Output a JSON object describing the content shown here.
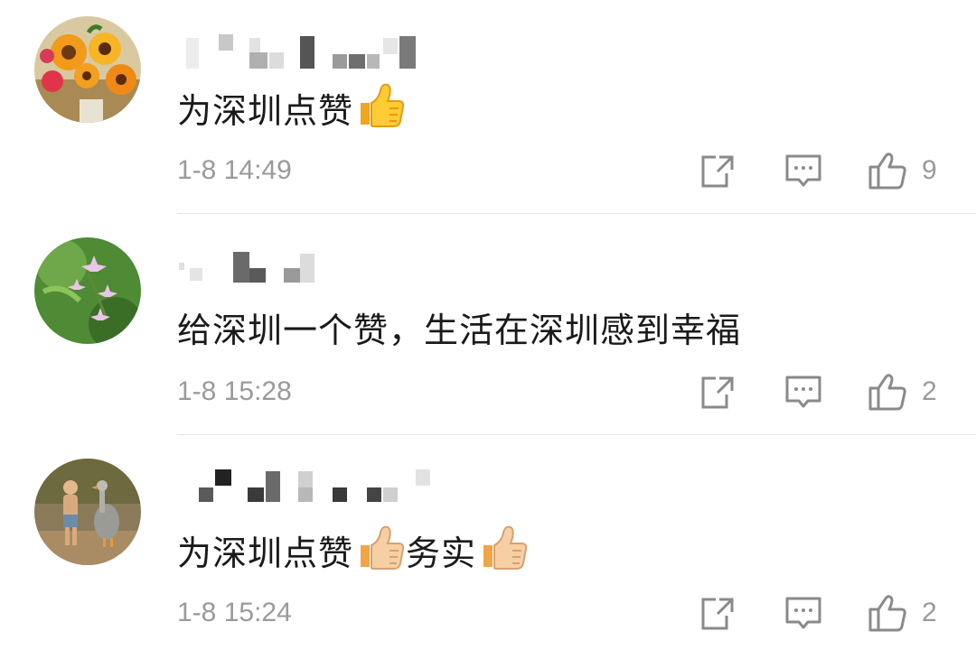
{
  "comments": [
    {
      "avatar_icon": "sunflower-bouquet-avatar",
      "text": "为深圳点赞",
      "emoji": "thumbs-up-yellow",
      "time": "1-8 14:49",
      "likes": "9"
    },
    {
      "avatar_icon": "pink-flower-avatar",
      "text": "给深圳一个赞，生活在深圳感到幸福",
      "time": "1-8 15:28",
      "likes": "2"
    },
    {
      "avatar_icon": "child-with-goose-avatar",
      "text_part1": "为深圳点赞",
      "text_part2": "务实",
      "emoji": "thumbs-up-light",
      "time": "1-8 15:24",
      "likes": "2"
    }
  ],
  "icons": {
    "share": "share-icon",
    "reply": "comment-icon",
    "like": "thumbs-up-icon"
  },
  "colors": {
    "meta_text": "#9a9a9a",
    "body_text": "#1a1a1a",
    "icon_stroke": "#8a8a8a"
  }
}
